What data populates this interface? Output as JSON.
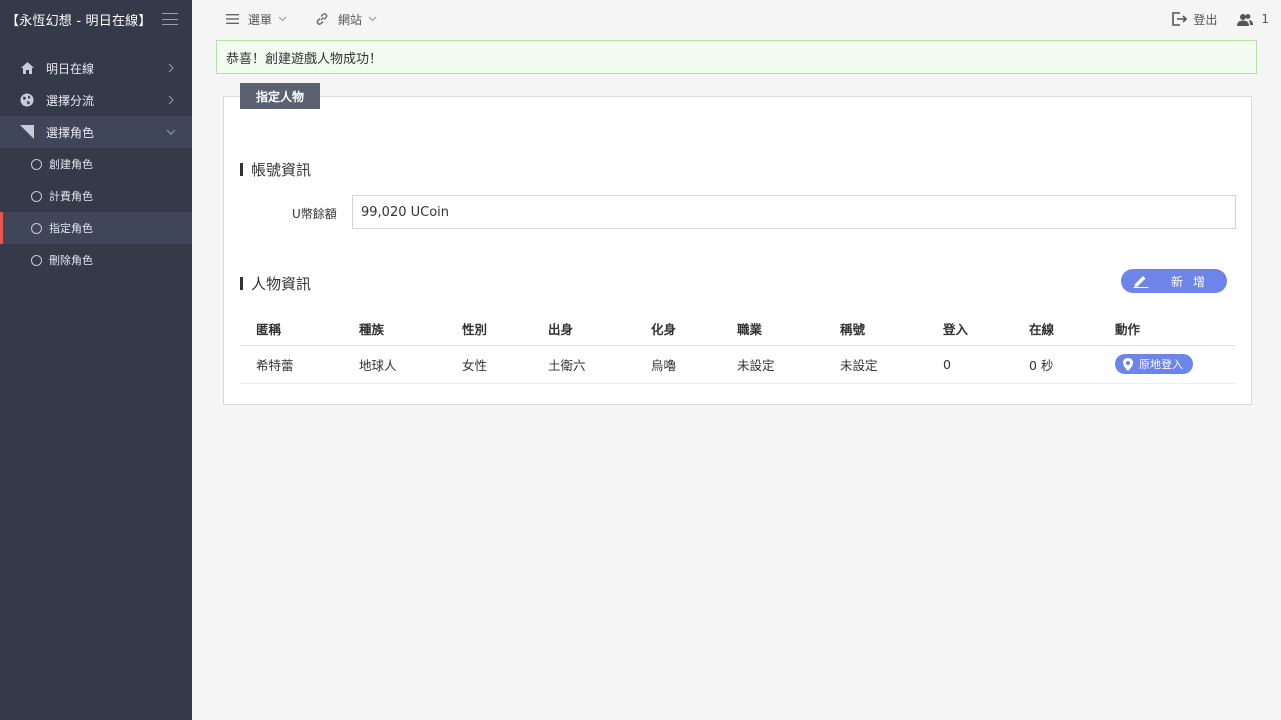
{
  "sidebar": {
    "brand": "【永恆幻想 - 明日在線】",
    "items": [
      {
        "label": "明日在線",
        "icon": "home-icon"
      },
      {
        "label": "選擇分流",
        "icon": "globe-icon"
      },
      {
        "label": "選擇角色",
        "icon": "wedge-icon"
      }
    ],
    "subitems": [
      {
        "label": "創建角色"
      },
      {
        "label": "計費角色"
      },
      {
        "label": "指定角色"
      },
      {
        "label": "刪除角色"
      }
    ]
  },
  "topbar": {
    "menu_label": "選單",
    "site_label": "網站",
    "logout_label": "登出",
    "user_count": "1"
  },
  "alert": {
    "message": "恭喜！創建遊戲人物成功！"
  },
  "panel": {
    "tab_label": "指定人物",
    "account_title": "帳號資訊",
    "balance_label": "U幣餘額",
    "balance_value": "99,020 UCoin",
    "characters_title": "人物資訊",
    "add_button": "新增",
    "table": {
      "headers": [
        "匿稱",
        "種族",
        "性別",
        "出身",
        "化身",
        "職業",
        "稱號",
        "登入",
        "在線",
        "動作"
      ],
      "rows": [
        {
          "nickname": "希特蕾",
          "race": "地球人",
          "gender": "女性",
          "origin": "土衛六",
          "avatar": "烏嚕",
          "job": "未設定",
          "title": "未設定",
          "logins": "0",
          "online": "0 秒",
          "action": "原地登入"
        }
      ]
    }
  },
  "colors": {
    "sidebar_bg": "#343a4a",
    "active_marker": "#e9554a",
    "accent_button": "#6d84e8",
    "alert_bg": "#f2fbf0",
    "alert_border": "#b5e0a8",
    "tab_bg": "#5a6170"
  }
}
